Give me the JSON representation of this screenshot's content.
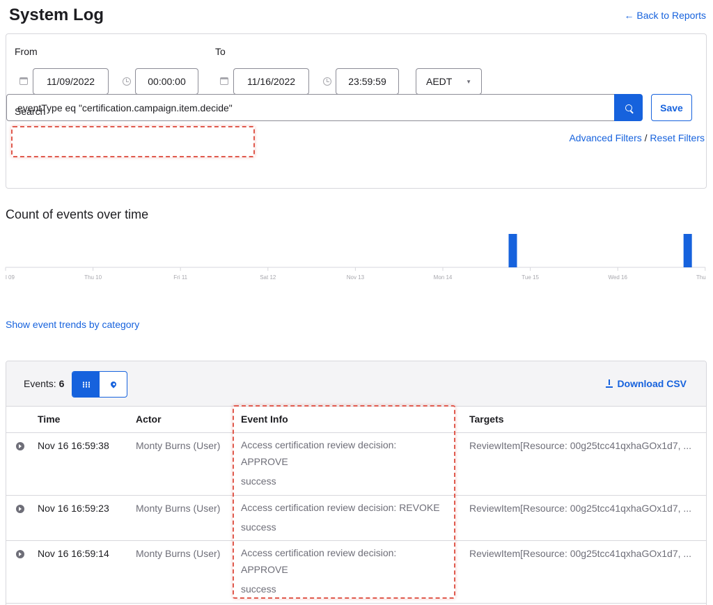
{
  "header": {
    "title": "System Log",
    "back_link": "← Back to Reports"
  },
  "filters": {
    "from_label": "From",
    "to_label": "To",
    "from_date": "11/09/2022",
    "from_time": "00:00:00",
    "to_date": "11/16/2022",
    "to_time": "23:59:59",
    "timezone": "AEDT",
    "search_label": "Search",
    "search_value": "eventType eq \"certification.campaign.item.decide\"",
    "save_label": "Save",
    "advanced_filters": "Advanced Filters",
    "separator": " / ",
    "reset_filters": "Reset Filters"
  },
  "chart_data": {
    "type": "bar",
    "title": "Count of events over time",
    "categories": [
      "l 09",
      "Thu 10",
      "Fri 11",
      "Sat 12",
      "Nov 13",
      "Mon 14",
      "Tue 15",
      "Wed 16",
      "Thu"
    ],
    "bars": [
      {
        "x": 5.8,
        "value": 3
      },
      {
        "x": 7.8,
        "value": 3
      }
    ],
    "xlim": [
      0,
      8
    ],
    "grid": false
  },
  "trend_link": "Show event trends by category",
  "events": {
    "count_label": "Events:",
    "count": "6",
    "download_label": "Download CSV",
    "columns": [
      "Time",
      "Actor",
      "Event Info",
      "Targets"
    ],
    "rows": [
      {
        "time": "Nov 16 16:59:38",
        "actor": "Monty Burns (User)",
        "info_line1": "Access certification review decision:",
        "info_line2": "APPROVE",
        "outcome": "success",
        "target": "ReviewItem[Resource: 00g25tcc41qxhaGOx1d7, ..."
      },
      {
        "time": "Nov 16 16:59:23",
        "actor": "Monty Burns (User)",
        "info_line1": "Access certification review decision: REVOKE",
        "info_line2": "",
        "outcome": "success",
        "target": "ReviewItem[Resource: 00g25tcc41qxhaGOx1d7, ..."
      },
      {
        "time": "Nov 16 16:59:14",
        "actor": "Monty Burns (User)",
        "info_line1": "Access certification review decision:",
        "info_line2": "APPROVE",
        "outcome": "success",
        "target": "ReviewItem[Resource: 00g25tcc41qxhaGOx1d7, ..."
      }
    ]
  },
  "colors": {
    "accent": "#1662dd",
    "annotation": "#e05a4e",
    "muted_text": "#6e6e78"
  }
}
